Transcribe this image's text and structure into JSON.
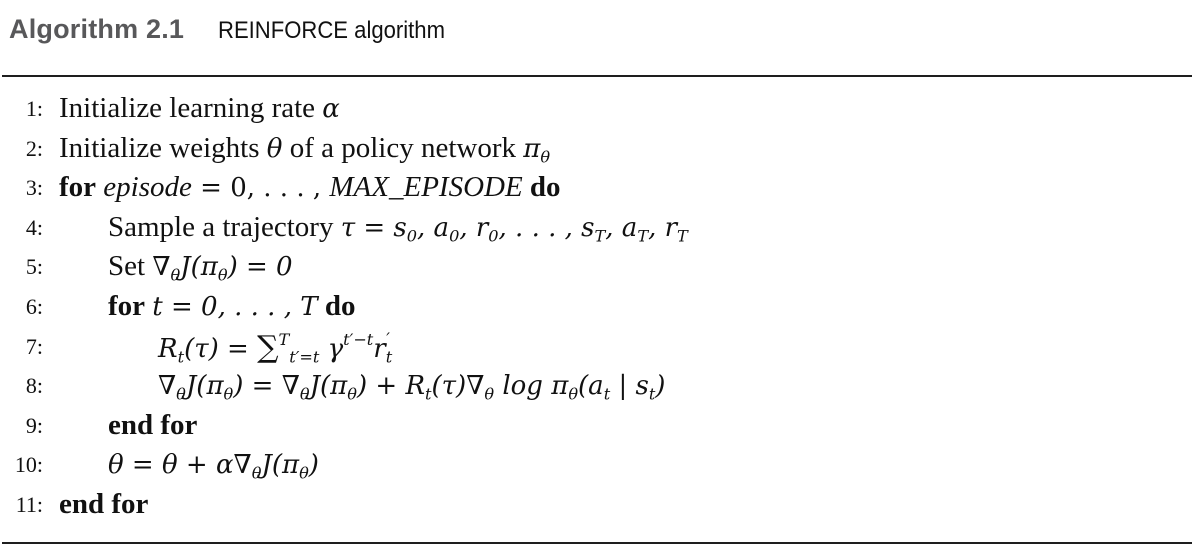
{
  "document": {
    "algorithm_number": "Algorithm 2.1",
    "algorithm_title": "REINFORCE algorithm",
    "lines": [
      {
        "num": "1:",
        "text": "Initialize learning rate",
        "math": "α"
      },
      {
        "num": "2:",
        "text": "Initialize weights",
        "math1": "θ",
        "text2": "of a policy network",
        "math2": "π",
        "math2_sub": "θ"
      },
      {
        "num": "3:",
        "kw1": "for",
        "var": "episode",
        "eq": " = 0, . . . , ",
        "bound": "MAX_EPISODE",
        "kw2": "do"
      },
      {
        "num": "4:",
        "text": "Sample a trajectory",
        "math": "τ = s₀, a₀, r₀, . . . , s_T, a_T, r_T"
      },
      {
        "num": "5:",
        "text": "Set",
        "math": "∇_θ J(π_θ) = 0"
      },
      {
        "num": "6:",
        "kw1": "for",
        "math": "t = 0, . . . , T",
        "kw2": "do"
      },
      {
        "num": "7:",
        "math": "R_t(τ) = Σ_{t'=t}^{T} γ^{t'−t} r'_t"
      },
      {
        "num": "8:",
        "math": "∇_θ J(π_θ) = ∇_θ J(π_θ) + R_t(τ)∇_θ log π_θ(a_t | s_t)"
      },
      {
        "num": "9:",
        "kw1": "end for"
      },
      {
        "num": "10:",
        "math": "θ = θ + α∇_θ J(π_θ)"
      },
      {
        "num": "11:",
        "kw1": "end for"
      }
    ]
  }
}
